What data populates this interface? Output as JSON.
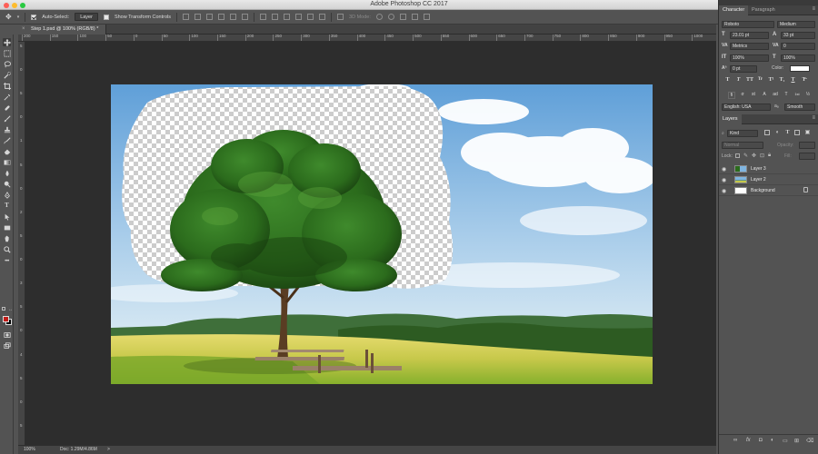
{
  "app": {
    "title": "Adobe Photoshop CC 2017"
  },
  "options_bar": {
    "auto_select_label": "Auto-Select:",
    "auto_select_checked": true,
    "auto_select_target": "Layer",
    "show_transform_label": "Show Transform Controls",
    "show_transform_checked": false,
    "mode_3d_label": "3D Mode:"
  },
  "document": {
    "tab_title": "Step 1.psd @ 100% (RGB/8) *",
    "ruler_h_labels": [
      "200",
      "150",
      "100",
      "50",
      "0",
      "50",
      "100",
      "150",
      "200",
      "250",
      "300",
      "350",
      "400",
      "450",
      "500",
      "550",
      "600",
      "650",
      "700",
      "750",
      "800",
      "850",
      "900",
      "950",
      "1000"
    ],
    "ruler_v_labels": [
      "5",
      "0",
      "5",
      "0",
      "1",
      "5",
      "0",
      "2",
      "5",
      "0",
      "3",
      "5",
      "0",
      "4",
      "5",
      "0",
      "5"
    ]
  },
  "status": {
    "zoom": "100%",
    "doc_size": "Doc: 1.29M/4.86M",
    "arrow": ">"
  },
  "colors": {
    "foreground": "#c11b17",
    "background": "#000000",
    "accent": "#3b3b3b"
  },
  "character_panel": {
    "tabs": [
      "Character",
      "Paragraph"
    ],
    "font_family": "Roboto",
    "font_style": "Medium",
    "font_size": "23.01 pt",
    "leading": "33 pt",
    "kerning": "Metrics",
    "tracking": "0",
    "vertical_scale": "100%",
    "horizontal_scale": "100%",
    "baseline_shift": "0 pt",
    "color_label": "Color:",
    "type_style_buttons": [
      "T",
      "T",
      "TT",
      "Tr",
      "T¹",
      "T₁",
      "T",
      "T̶"
    ],
    "opentype_buttons": [
      "fi",
      "σ",
      "st",
      "A",
      "ad",
      "T",
      "1st",
      "½"
    ],
    "language": "English: USA",
    "aa_label": "aₐ",
    "antialiasing": "Smooth"
  },
  "layers_panel": {
    "tab": "Layers",
    "filter_kind": "Kind",
    "blend_mode": "Normal",
    "opacity_label": "Opacity:",
    "lock_label": "Lock:",
    "fill_label": "Fill:",
    "layers": [
      {
        "name": "Layer 3",
        "visible": true,
        "selected": false
      },
      {
        "name": "Layer 2",
        "visible": true,
        "selected": false
      },
      {
        "name": "Background",
        "visible": true,
        "selected": false,
        "locked": true
      }
    ],
    "footer_buttons": [
      "link-icon",
      "fx-icon",
      "mask-icon",
      "adjustment-icon",
      "group-icon",
      "new-layer-icon",
      "trash-icon"
    ]
  },
  "toolbar": {
    "tools": [
      "move-icon",
      "marquee-icon",
      "lasso-icon",
      "quick-select-icon",
      "crop-icon",
      "eyedropper-icon",
      "healing-icon",
      "brush-icon",
      "stamp-icon",
      "history-brush-icon",
      "eraser-icon",
      "gradient-icon",
      "blur-icon",
      "dodge-icon",
      "pen-icon",
      "type-icon",
      "path-select-icon",
      "rectangle-icon",
      "hand-icon",
      "zoom-icon",
      "more-icon"
    ]
  }
}
